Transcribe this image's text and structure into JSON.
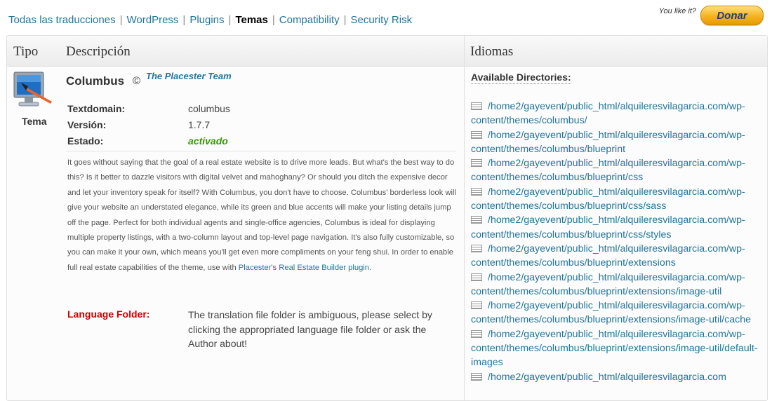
{
  "nav": {
    "items": [
      {
        "label": "Todas las traducciones"
      },
      {
        "label": "WordPress"
      },
      {
        "label": "Plugins"
      },
      {
        "label": "Temas"
      },
      {
        "label": "Compatibility"
      },
      {
        "label": "Security Risk"
      }
    ],
    "separator": "|",
    "active": "Temas"
  },
  "donate": {
    "prompt": "You like it?",
    "button": "Donar"
  },
  "table": {
    "headers": {
      "tipo": "Tipo",
      "descripcion": "Descripción",
      "idiomas": "Idiomas"
    }
  },
  "item": {
    "type_label": "Tema",
    "icon": "theme-monitor-icon",
    "name": "Columbus",
    "copyright": "©",
    "author": "The Placester Team",
    "fields": [
      {
        "key": "Textdomain:",
        "value": "columbus"
      },
      {
        "key": "Versión:",
        "value": "1.7.7"
      },
      {
        "key": "Estado:",
        "value": "activado"
      }
    ],
    "description_text": "It goes without saying that the goal of a real estate website is to drive more leads. But what's the best way to do this? Is it better to dazzle visitors with digital velvet and mahoghany? Or should you ditch the expensive decor and let your inventory speak for itself? With Columbus, you don't have to choose. Columbus' borderless look will give your website an understated elegance, while its green and blue accents will make your listing details jump off the page. Perfect for both individual agents and single-office agencies, Columbus is ideal for displaying multiple property listings, with a two-column layout and top-level page navigation. It's also fully customizable, so you can make it your own, which means you'll get even more compliments on your feng shui. In order to enable full real estate capabilities of the theme, use with ",
    "link_placester": "Placester",
    "link_connector": "'s ",
    "link_plugin": "Real Estate Builder plugin",
    "description_end": ".",
    "language_folder_label": "Language Folder:",
    "language_folder_text": "The translation file folder is ambiguous, please select by clicking the appropriated language file folder or ask the Author about!"
  },
  "idiomas": {
    "heading": "Available Directories:",
    "directories": [
      "/home2/gayevent/public_html/alquileresvilagarcia.com/wp-content/themes/columbus/",
      "/home2/gayevent/public_html/alquileresvilagarcia.com/wp-content/themes/columbus/blueprint",
      "/home2/gayevent/public_html/alquileresvilagarcia.com/wp-content/themes/columbus/blueprint/css",
      "/home2/gayevent/public_html/alquileresvilagarcia.com/wp-content/themes/columbus/blueprint/css/sass",
      "/home2/gayevent/public_html/alquileresvilagarcia.com/wp-content/themes/columbus/blueprint/css/styles",
      "/home2/gayevent/public_html/alquileresvilagarcia.com/wp-content/themes/columbus/blueprint/extensions",
      "/home2/gayevent/public_html/alquileresvilagarcia.com/wp-content/themes/columbus/blueprint/extensions/image-util",
      "/home2/gayevent/public_html/alquileresvilagarcia.com/wp-content/themes/columbus/blueprint/extensions/image-util/cache",
      "/home2/gayevent/public_html/alquileresvilagarcia.com/wp-content/themes/columbus/blueprint/extensions/image-util/default-images",
      "/home2/gayevent/public_html/alquileresvilagarcia.com"
    ]
  },
  "colors": {
    "link": "#21759b",
    "active_status": "#339900",
    "warning": "#cc0000",
    "donate": "#f6b221"
  }
}
